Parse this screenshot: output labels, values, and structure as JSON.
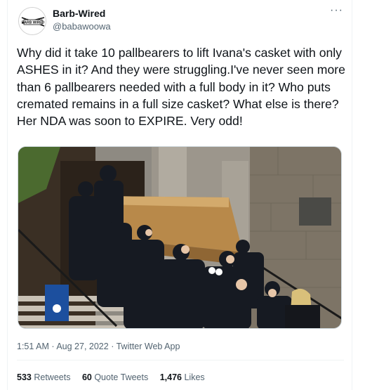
{
  "tweet": {
    "display_name": "Barb-Wired",
    "handle": "@babawoowa",
    "more_label": "···",
    "text": "Why did it take 10 pallbearers to lift Ivana's casket with only ASHES in it? And they were struggling.I've never seen more than 6 pallbearers needed with a full body in it? Who puts cremated remains in a full size casket? What else is there? Her NDA was soon to EXPIRE. Very odd!",
    "time": "1:51 AM",
    "separator": "·",
    "date": "Aug 27, 2022",
    "source": "Twitter Web App"
  },
  "stats": {
    "retweets_count": "533",
    "retweets_label": "Retweets",
    "quotes_count": "60",
    "quotes_label": "Quote Tweets",
    "likes_count": "1,476",
    "likes_label": "Likes"
  },
  "avatar_logo_text": "BARB WIRED",
  "colors": {
    "text_primary": "#0f1419",
    "text_secondary": "#536471",
    "divider": "#eff3f4",
    "casket_gold": "#b8894a"
  },
  "icons": [
    "more-icon",
    "avatar-logo"
  ]
}
